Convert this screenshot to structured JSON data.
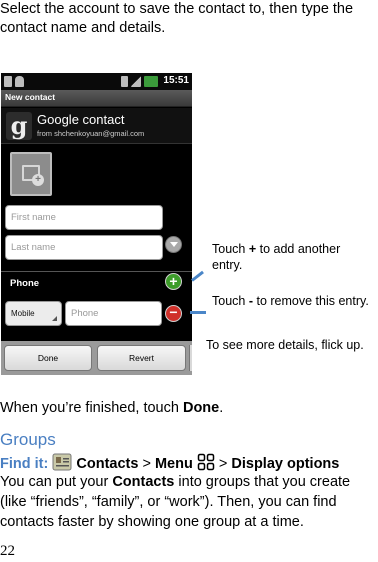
{
  "intro": "Select the account to save the contact to, then type the contact name and details.",
  "phone": {
    "status_time": "15:51",
    "title": "New contact",
    "account_name": "Google contact",
    "account_from": "from shchenkoyuan@gmail.com",
    "first_name_placeholder": "First name",
    "last_name_placeholder": "Last name",
    "phone_section": "Phone",
    "phone_type": "Mobile",
    "phone_placeholder": "Phone",
    "done_label": "Done",
    "revert_label": "Revert"
  },
  "callouts": {
    "add_pre": "Touch ",
    "add_sym": "+",
    "add_post": " to add another entry.",
    "remove_pre": "Touch ",
    "remove_sym": "-",
    "remove_post": " to remove this entry.",
    "more": "To see more details, flick up."
  },
  "finished": {
    "pre": "When you’re finished, touch ",
    "bold": "Done",
    "post": "."
  },
  "groups": {
    "heading": "Groups",
    "find_label": "Find it:",
    "contacts": "Contacts",
    "menu": "Menu",
    "display": "Display options",
    "sep": ">",
    "line1_pre": "You can put your ",
    "line1_bold": "Contacts",
    "line1_post": " into groups that you create",
    "line2": "(like “friends”, “family”, or “work”). Then, you can find",
    "line3": "contacts faster by showing one group at a time."
  },
  "page_number": "22",
  "colors": {
    "accent": "#4a7fc2",
    "callout_line": "#4a86c8"
  }
}
